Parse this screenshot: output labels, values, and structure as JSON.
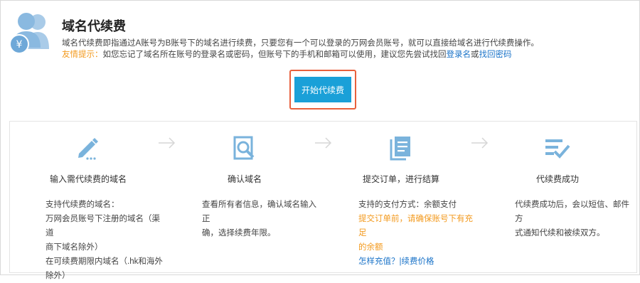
{
  "header": {
    "title": "域名代续费",
    "description": "域名代续费即指通过A账号为B账号下的域名进行续费，只要您有一个可以登录的万网会员账号，就可以直接给域名进行代续费操作。",
    "tip_label": "友情提示：",
    "tip_text": "如您忘记了域名所在账号的登录名或密码，但账号下的手机和邮箱可以使用，建议您先尝试找回",
    "tip_link_login": "登录名",
    "tip_or": "或",
    "tip_link_password": "找回密码"
  },
  "action": {
    "start_label": "开始代续费"
  },
  "steps": [
    {
      "icon": "pencil-icon",
      "title": "输入需代续费的域名",
      "lines": [
        "支持代续费的域名：",
        "万网会员账号下注册的域名（渠道",
        "商下域名除外）",
        "在可续费期限内域名（.hk和海外",
        "除外）"
      ]
    },
    {
      "icon": "search-document-icon",
      "title": "确认域名",
      "lines": [
        "查看所有者信息，确认域名输入正",
        "确，选择续费年限。"
      ]
    },
    {
      "icon": "documents-icon",
      "title": "提交订单，进行结算",
      "lines": [
        "支持的支付方式：余额支付"
      ],
      "warning_lines": [
        "提交订单前，请确保账号下有充足",
        "的余额"
      ],
      "link_recharge": "怎样充值？",
      "link_sep": "|",
      "link_price": "续费价格"
    },
    {
      "icon": "check-list-icon",
      "title": "代续费成功",
      "lines": [
        "代续费成功后，会以短信、邮件方",
        "式通知代续和被续双方。"
      ]
    }
  ],
  "colors": {
    "accent": "#1aa0d8",
    "icon": "#7ab3dc",
    "warning": "#f39a1e",
    "link": "#1a73c8",
    "highlight": "#e8603c"
  }
}
